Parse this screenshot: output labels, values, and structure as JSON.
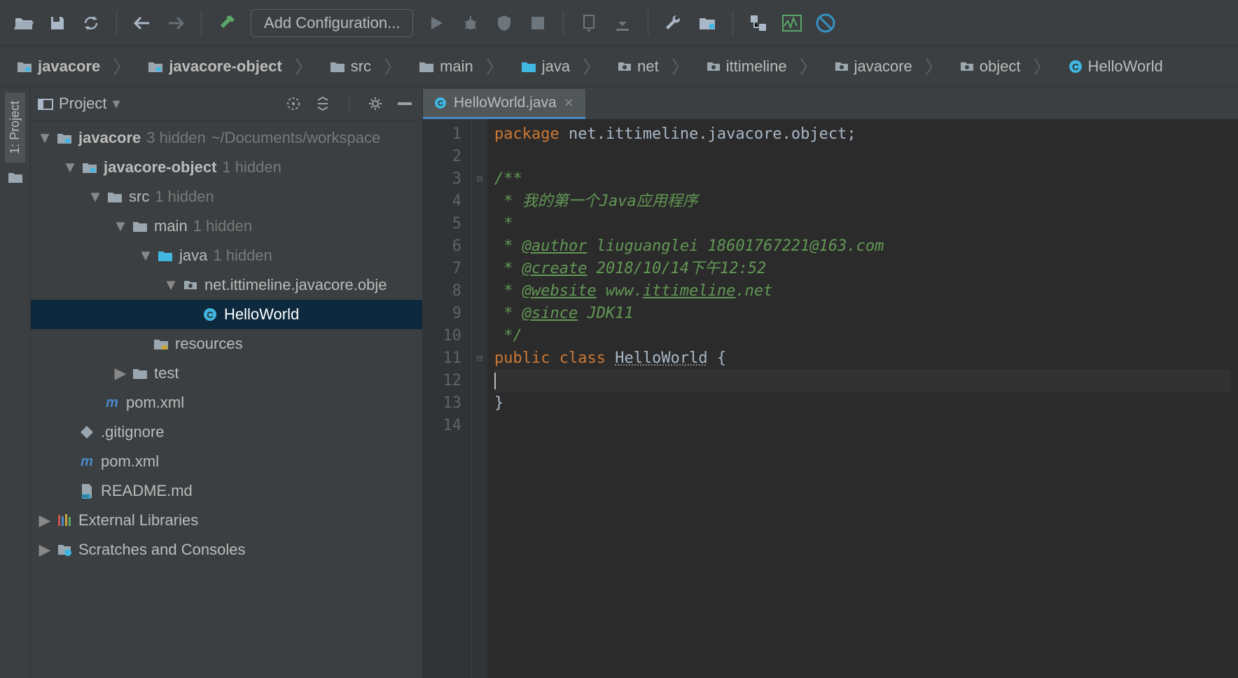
{
  "toolbar": {
    "config_label": "Add Configuration..."
  },
  "breadcrumb": [
    {
      "icon": "module",
      "label": "javacore"
    },
    {
      "icon": "module",
      "label": "javacore-object"
    },
    {
      "icon": "src",
      "label": "src"
    },
    {
      "icon": "src",
      "label": "main"
    },
    {
      "icon": "src",
      "label": "java"
    },
    {
      "icon": "pkg",
      "label": "net"
    },
    {
      "icon": "pkg",
      "label": "ittimeline"
    },
    {
      "icon": "pkg",
      "label": "javacore"
    },
    {
      "icon": "pkg",
      "label": "object"
    },
    {
      "icon": "class",
      "label": "HelloWorld"
    }
  ],
  "gutter_tab": "1: Project",
  "panel": {
    "title": "Project"
  },
  "tree": {
    "root": {
      "label": "javacore",
      "extra": "3 hidden",
      "path": "~/Documents/workspace"
    },
    "module": {
      "label": "javacore-object",
      "extra": "1 hidden"
    },
    "src": {
      "label": "src",
      "extra": "1 hidden"
    },
    "main": {
      "label": "main",
      "extra": "1 hidden"
    },
    "java": {
      "label": "java",
      "extra": "1 hidden"
    },
    "pkg": {
      "label": "net.ittimeline.javacore.obje"
    },
    "cls": {
      "label": "HelloWorld"
    },
    "resources": {
      "label": "resources"
    },
    "test": {
      "label": "test"
    },
    "pom1": {
      "label": "pom.xml"
    },
    "gitignore": {
      "label": ".gitignore"
    },
    "pom2": {
      "label": "pom.xml"
    },
    "readme": {
      "label": "README.md"
    },
    "extlib": {
      "label": "External Libraries"
    },
    "scratches": {
      "label": "Scratches and Consoles"
    }
  },
  "editor": {
    "tab_label": "HelloWorld.java",
    "line_count": 14,
    "code": {
      "l1_package": "package",
      "l1_rest": " net.ittimeline.javacore.object;",
      "l3": "/**",
      "l4": " * 我的第一个Java应用程序",
      "l5": " *",
      "l6_pre": " * ",
      "l6_tag": "@author",
      "l6_rest": " liuguanglei 18601767221@163.com",
      "l7_pre": " * ",
      "l7_tag": "@create",
      "l7_rest": " 2018/10/14下午12:52",
      "l8_pre": " * ",
      "l8_tag": "@website",
      "l8_rest": " www.",
      "l8_link": "ittimeline",
      "l8_rest2": ".net",
      "l9_pre": " * ",
      "l9_tag": "@since",
      "l9_rest": " JDK11",
      "l10": " */",
      "l11_public": "public",
      "l11_class": " class ",
      "l11_name": "HelloWorld",
      "l11_rest": " {",
      "l13": "}"
    }
  }
}
